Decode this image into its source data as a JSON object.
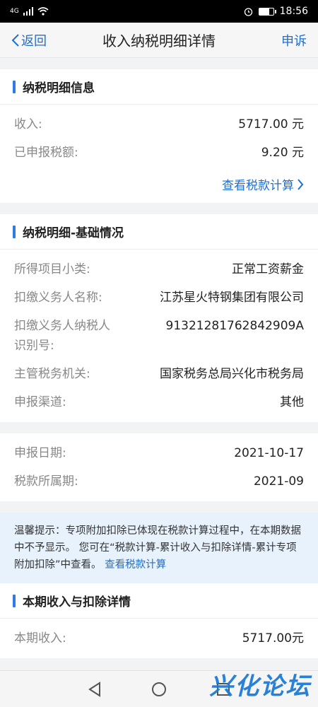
{
  "status": {
    "network": "4G",
    "time": "18:56"
  },
  "nav": {
    "back_label": "返回",
    "title": "收入纳税明细详情",
    "right_label": "申诉"
  },
  "section1": {
    "title": "纳税明细信息",
    "rows": [
      {
        "label": "收入:",
        "value": "5717.00 元"
      },
      {
        "label": "已申报税额:",
        "value": "9.20 元"
      }
    ],
    "link": "查看税款计算"
  },
  "section2": {
    "title": "纳税明细-基础情况",
    "rows": [
      {
        "label": "所得项目小类:",
        "value": "正常工资薪金"
      },
      {
        "label": "扣缴义务人名称:",
        "value": "江苏星火特钢集团有限公司"
      },
      {
        "label": "扣缴义务人纳税人识别号:",
        "value": "91321281762842909A"
      },
      {
        "label": "主管税务机关:",
        "value": "国家税务总局兴化市税务局"
      },
      {
        "label": "申报渠道:",
        "value": "其他"
      }
    ]
  },
  "section3": {
    "rows": [
      {
        "label": "申报日期:",
        "value": "2021-10-17"
      },
      {
        "label": "税款所属期:",
        "value": "2021-09"
      }
    ]
  },
  "notice": {
    "text": "温馨提示：专项附加扣除已体现在税款计算过程中，在本期数据中不予显示。 您可在“税款计算-累计收入与扣除详情-累计专项附加扣除”中查看。",
    "link": "查看税款计算"
  },
  "section4": {
    "title": "本期收入与扣除详情",
    "rows": [
      {
        "label": "本期收入:",
        "value": "5717.00元"
      }
    ]
  },
  "watermark": "兴化论坛",
  "colors": {
    "accent": "#1f6fd1",
    "bar": "#2f7ae5",
    "notice_bg": "#e7f2fd"
  }
}
